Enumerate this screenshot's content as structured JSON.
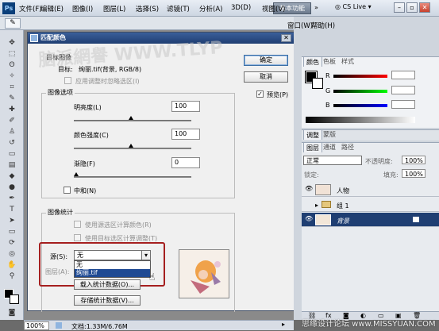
{
  "menubar": {
    "logo": "Ps",
    "items": [
      "文件(F)",
      "编辑(E)",
      "图像(I)",
      "图层(L)",
      "选择(S)",
      "滤镜(T)",
      "分析(A)",
      "3D(D)",
      "视图(V)",
      "窗口(W)",
      "帮助(H)"
    ],
    "workspace_button": "基本功能",
    "cs_live": "CS Live"
  },
  "dialog": {
    "title": "匹配颜色",
    "target_group": "目标图像",
    "target_label": "目标:",
    "target_value": "绚丽.tif(背景, RGB/8)",
    "apply_adjust_label": "应用调整时忽略选区(I)",
    "image_options_group": "图像选项",
    "luminance_label": "明亮度(L)",
    "luminance_value": "100",
    "color_intensity_label": "颜色强度(C)",
    "color_intensity_value": "100",
    "fade_label": "渐隐(F)",
    "fade_value": "0",
    "neutralize_label": "中和(N)",
    "image_stats_group": "图像统计",
    "use_source_sel_label": "使用源选区计算颜色(R)",
    "use_target_sel_label": "使用目标选区计算调整(T)",
    "source_label": "源(S):",
    "source_value": "无",
    "source_options": [
      "无",
      "绚丽.tif"
    ],
    "layer_label": "图层(A):",
    "load_stats_button": "载入统计数据(O)...",
    "save_stats_button": "存储统计数据(V)...",
    "ok_button": "确定",
    "cancel_button": "取消",
    "preview_label": "预览(P)",
    "preview_checked": true
  },
  "color_panel": {
    "tabs": [
      "颜色",
      "色板",
      "样式"
    ],
    "channels": [
      "R",
      "G",
      "B"
    ],
    "channel_values": [
      "",
      "",
      ""
    ]
  },
  "adjust_panel": {
    "tabs": [
      "调整",
      "蒙版"
    ]
  },
  "layers_panel": {
    "tabs": [
      "图层",
      "通道",
      "路径"
    ],
    "blend_mode": "正常",
    "opacity_label": "不透明度:",
    "opacity_value": "100%",
    "lock_label": "锁定:",
    "fill_label": "填充:",
    "fill_value": "100%",
    "layers": [
      {
        "name": "人物",
        "visible": true
      },
      {
        "name": "组 1",
        "visible": false
      },
      {
        "name": "背景",
        "visible": true
      }
    ]
  },
  "statusbar": {
    "zoom": "100%",
    "doc": "文档:1.33M/6.76M"
  },
  "watermarks": {
    "top": "脑派網譽 WWW.TLYP",
    "bottom": "思缘设计论坛 www.MISSYUAN.COM"
  },
  "colors": {
    "menubar_bg": "#dfe5ee",
    "dialog_title": "#1f3e72",
    "highlight_border": "#a51f1f",
    "selected_layer": "#1f3e72"
  }
}
